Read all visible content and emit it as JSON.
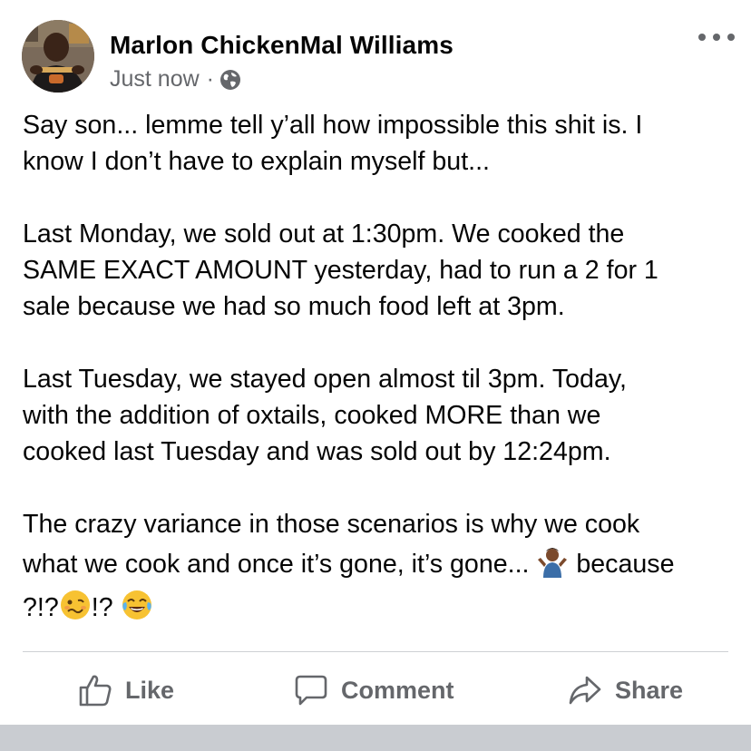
{
  "post": {
    "author": "Marlon ChickenMal Williams",
    "timestamp": "Just now",
    "separator": "·",
    "privacy_icon": "globe-icon",
    "more_icon": "more-options-icon",
    "text": {
      "p1_l1": "Say son... lemme tell y’all how impossible this shit is. I",
      "p1_l2": "know I don’t have to explain myself but...",
      "p2_l1": "Last Monday, we sold out at 1:30pm. We cooked the",
      "p2_l2": "SAME EXACT AMOUNT yesterday, had to run a 2 for 1",
      "p2_l3": "sale because we had so much food left at 3pm.",
      "p3_l1": "Last Tuesday, we stayed open almost til 3pm. Today,",
      "p3_l2": "with the addition of oxtails, cooked MORE than we",
      "p3_l3": "cooked last Tuesday and was sold out by 12:24pm.",
      "p4_l1": "The crazy variance in those scenarios is why we cook",
      "p4_l2a": "what we cook and once it’s gone, it’s gone... ",
      "p4_l2b": " because",
      "p4_l3a": "?!?",
      "p4_l3b": "!?"
    },
    "emojis": [
      "person-shrugging-emoji",
      "woozy-face-emoji",
      "face-with-tears-of-joy-emoji"
    ]
  },
  "actions": {
    "like": "Like",
    "comment": "Comment",
    "share": "Share"
  },
  "colors": {
    "text": "#050505",
    "secondary": "#65676b",
    "divider": "#ced0d4",
    "band": "#c9ccd1"
  }
}
